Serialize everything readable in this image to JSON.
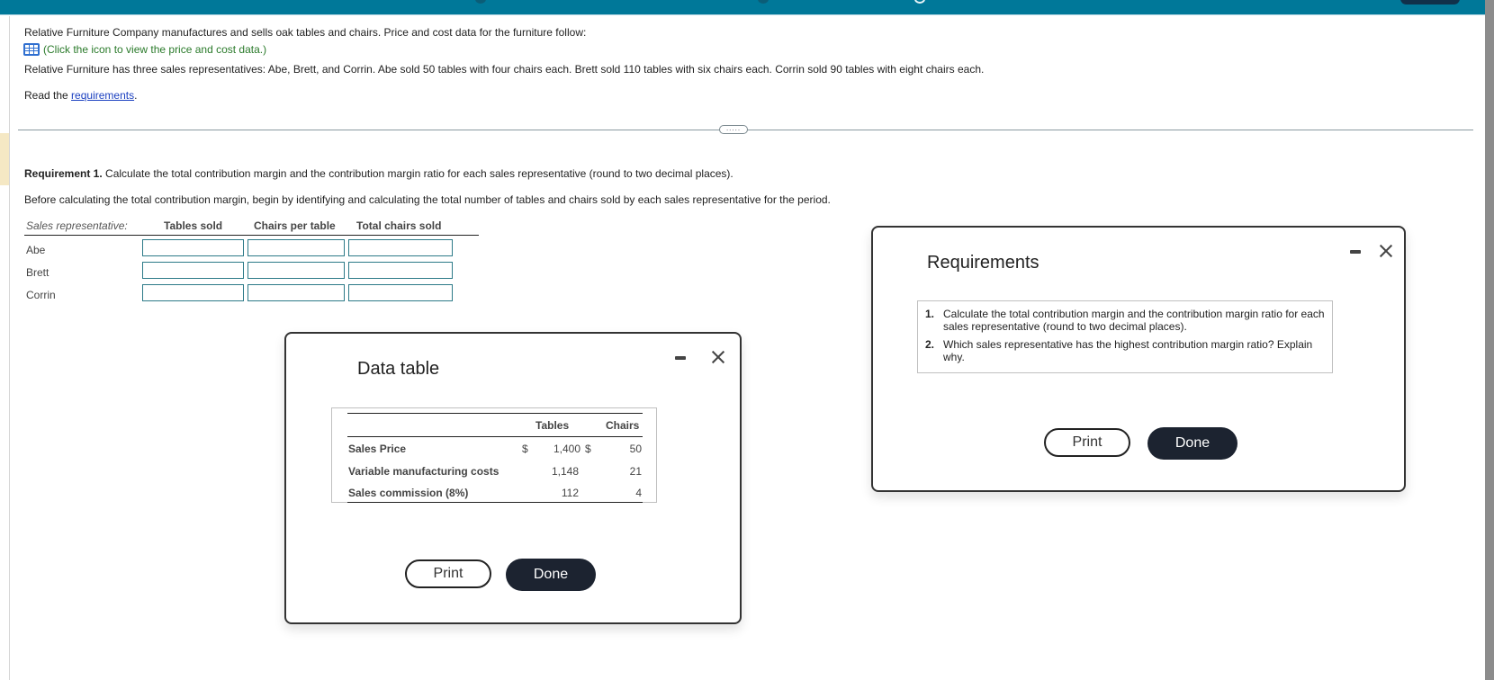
{
  "intro": {
    "line1": "Relative Furniture Company manufactures and sells oak tables and chairs. Price and cost data for the furniture follow:",
    "data_link_text": "(Click the icon to view the price and cost data.)",
    "line3": "Relative Furniture has three sales representatives: Abe, Brett, and Corrin. Abe sold 50 tables with four chairs each. Brett sold 110 tables with six chairs each. Corrin sold 90 tables with eight chairs each.",
    "read_prefix": "Read the ",
    "requirements_link": "requirements",
    "read_suffix": "."
  },
  "divider": {
    "ellipsis_label": "....."
  },
  "requirement1": {
    "label": "Requirement 1.",
    "text": " Calculate the total contribution margin and the contribution margin ratio for each sales representative (round to two decimal places).",
    "instruction": "Before calculating the total contribution margin, begin by identifying and calculating the total number of tables and chairs sold by each sales representative for the period."
  },
  "entry_table": {
    "rep_header": "Sales representative:",
    "columns": [
      "Tables sold",
      "Chairs per table",
      "Total chairs sold"
    ],
    "rows": [
      {
        "rep": "Abe",
        "tables_sold": "",
        "chairs_per_table": "",
        "total_chairs_sold": ""
      },
      {
        "rep": "Brett",
        "tables_sold": "",
        "chairs_per_table": "",
        "total_chairs_sold": ""
      },
      {
        "rep": "Corrin",
        "tables_sold": "",
        "chairs_per_table": "",
        "total_chairs_sold": ""
      }
    ]
  },
  "data_table_modal": {
    "title": "Data table",
    "col_tables": "Tables",
    "col_chairs": "Chairs",
    "currency": "$",
    "rows": [
      {
        "label": "Sales Price",
        "tables": "1,400",
        "chairs": "50",
        "show_currency": true
      },
      {
        "label": "Variable manufacturing costs",
        "tables": "1,148",
        "chairs": "21",
        "show_currency": false
      },
      {
        "label": "Sales commission (8%)",
        "tables": "112",
        "chairs": "4",
        "show_currency": false
      }
    ],
    "print_label": "Print",
    "done_label": "Done"
  },
  "requirements_modal": {
    "title": "Requirements",
    "items": [
      {
        "num": "1.",
        "text": "Calculate the total contribution margin and the contribution margin ratio for each sales representative (round to two decimal places)."
      },
      {
        "num": "2.",
        "text": "Which sales representative has the highest contribution margin ratio? Explain why."
      }
    ],
    "print_label": "Print",
    "done_label": "Done"
  }
}
